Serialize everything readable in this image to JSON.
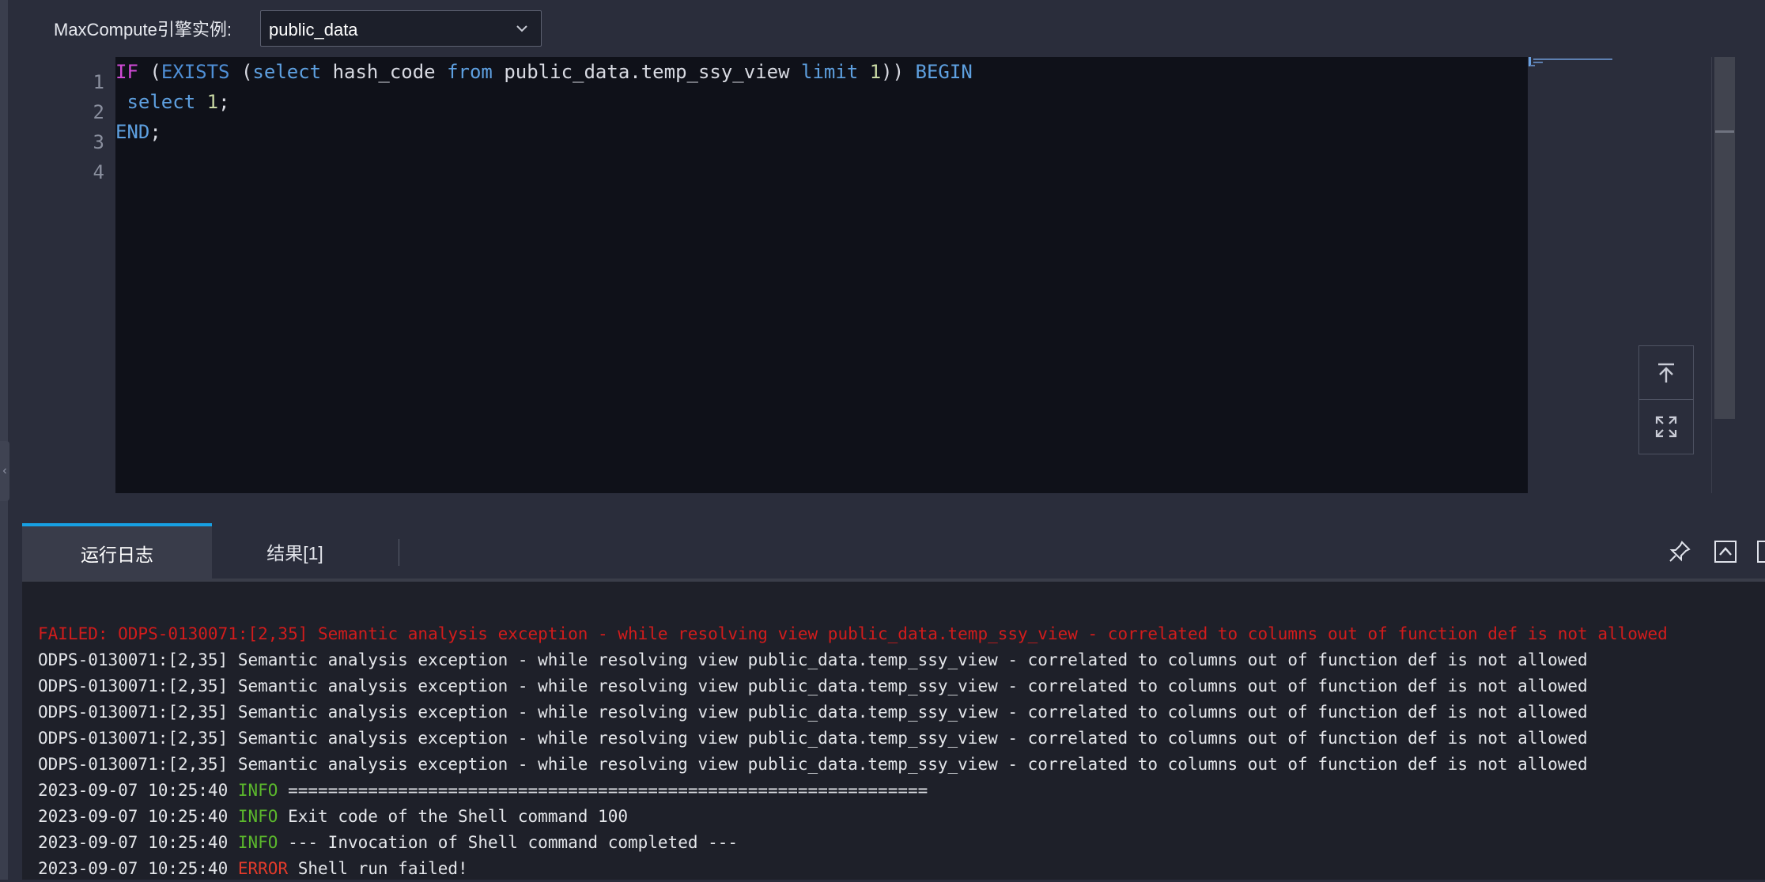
{
  "engine": {
    "label": "MaxCompute引擎实例:",
    "selected": "public_data"
  },
  "editor": {
    "line_numbers": [
      "1",
      "2",
      "3",
      "4"
    ],
    "lines": [
      {
        "tokens": [
          {
            "text": "IF",
            "kind": "kw-magenta"
          },
          {
            "text": " (",
            "kind": "plain"
          },
          {
            "text": "EXISTS",
            "kind": "kw-blue"
          },
          {
            "text": " (",
            "kind": "plain"
          },
          {
            "text": "select",
            "kind": "kw-lightblue"
          },
          {
            "text": " hash_code ",
            "kind": "plain"
          },
          {
            "text": "from",
            "kind": "kw-lightblue"
          },
          {
            "text": " public_data.temp_ssy_view ",
            "kind": "plain"
          },
          {
            "text": "limit",
            "kind": "kw-lightblue"
          },
          {
            "text": " ",
            "kind": "plain"
          },
          {
            "text": "1",
            "kind": "num"
          },
          {
            "text": ")) ",
            "kind": "plain"
          },
          {
            "text": "BEGIN",
            "kind": "kw-lightblue"
          }
        ]
      },
      {
        "tokens": [
          {
            "text": " ",
            "kind": "plain"
          },
          {
            "text": "select",
            "kind": "kw-lightblue"
          },
          {
            "text": " ",
            "kind": "plain"
          },
          {
            "text": "1",
            "kind": "num"
          },
          {
            "text": ";",
            "kind": "plain"
          }
        ]
      },
      {
        "tokens": [
          {
            "text": "END",
            "kind": "kw-lightblue"
          },
          {
            "text": ";",
            "kind": "plain"
          }
        ]
      },
      {
        "tokens": []
      }
    ]
  },
  "floating_buttons": {
    "scroll_top_icon": "arrow-to-top-icon",
    "fullscreen_icon": "expand-icon"
  },
  "panel": {
    "tabs": [
      {
        "label": "运行日志",
        "active": true
      },
      {
        "label": "结果[1]",
        "active": false
      }
    ],
    "icons": [
      "pin-icon",
      "collapse-up-icon",
      "maximize-icon"
    ]
  },
  "log": {
    "failed_line": "FAILED: ODPS-0130071:[2,35] Semantic analysis exception - while resolving view public_data.temp_ssy_view - correlated to columns out of function def is not allowed",
    "error_lines": [
      "ODPS-0130071:[2,35] Semantic analysis exception - while resolving view public_data.temp_ssy_view - correlated to columns out of function def is not allowed",
      "ODPS-0130071:[2,35] Semantic analysis exception - while resolving view public_data.temp_ssy_view - correlated to columns out of function def is not allowed",
      "ODPS-0130071:[2,35] Semantic analysis exception - while resolving view public_data.temp_ssy_view - correlated to columns out of function def is not allowed",
      "ODPS-0130071:[2,35] Semantic analysis exception - while resolving view public_data.temp_ssy_view - correlated to columns out of function def is not allowed",
      "ODPS-0130071:[2,35] Semantic analysis exception - while resolving view public_data.temp_ssy_view - correlated to columns out of function def is not allowed"
    ],
    "entries": [
      {
        "timestamp": "2023-09-07 10:25:40",
        "level": "INFO",
        "message": "================================================================"
      },
      {
        "timestamp": "2023-09-07 10:25:40",
        "level": "INFO",
        "message": "Exit code of the Shell command 100"
      },
      {
        "timestamp": "2023-09-07 10:25:40",
        "level": "INFO",
        "message": "--- Invocation of Shell command completed ---"
      },
      {
        "timestamp": "2023-09-07 10:25:40",
        "level": "ERROR",
        "message": "Shell run failed!"
      }
    ]
  },
  "colors": {
    "accent": "#17a0e3",
    "error": "#d21c1c",
    "info": "#5bb82c"
  }
}
